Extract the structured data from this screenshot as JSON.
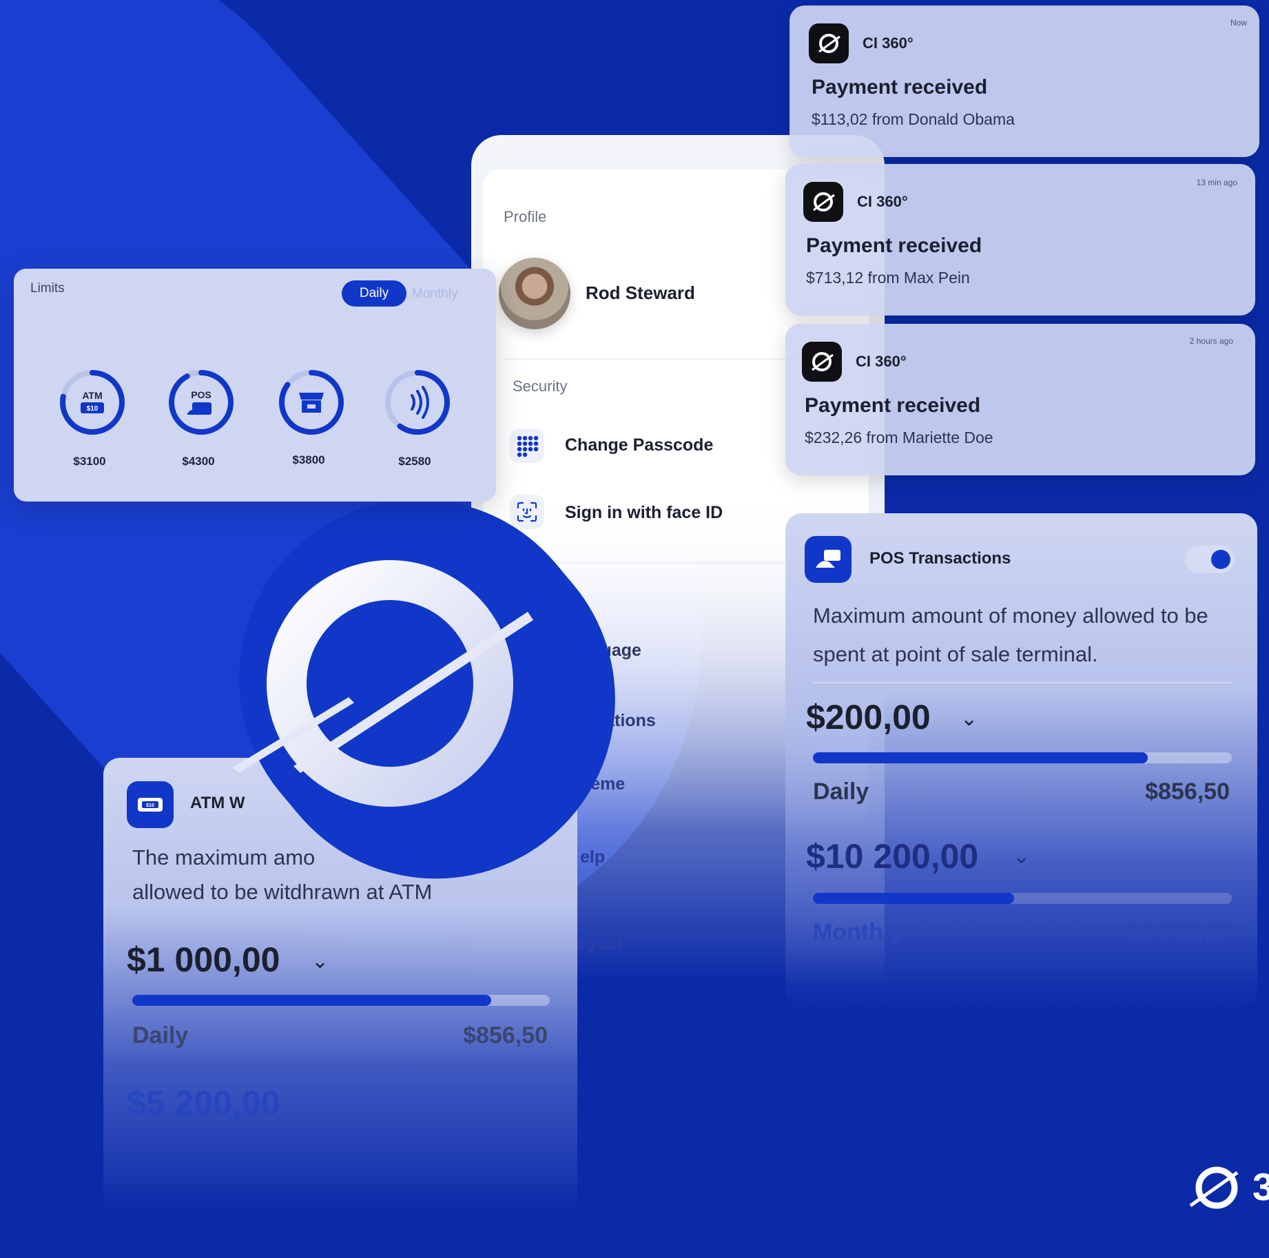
{
  "colors": {
    "background": "#0b2aa8",
    "accent": "#1137c8",
    "card": "#cfd6f2",
    "text_dark": "#1b1f2f"
  },
  "limits": {
    "title": "Limits",
    "tabs": {
      "daily": "Daily",
      "monthly": "Monthly"
    },
    "active_tab": "Daily",
    "items": [
      {
        "icon": "atm-icon",
        "badge_top": "ATM",
        "badge_bottom": "$10",
        "value": "$3100",
        "progress": 0.78
      },
      {
        "icon": "pos-terminal-icon",
        "badge_top": "POS",
        "value": "$4300",
        "progress": 0.92
      },
      {
        "icon": "shop-icon",
        "value": "$3800",
        "progress": 0.85
      },
      {
        "icon": "contactless-icon",
        "value": "$2580",
        "progress": 0.6
      }
    ]
  },
  "profile": {
    "section": "Profile",
    "name": "Rod Steward",
    "security_section": "Security",
    "menu": [
      {
        "icon": "passcode-grid-icon",
        "label": "Change Passcode"
      },
      {
        "icon": "face-id-icon",
        "label": "Sign in with face ID"
      }
    ],
    "general_section_partial": "l",
    "general_items_partial": [
      "nguage",
      "ifications",
      "heme",
      "elp",
      "og out"
    ]
  },
  "notifications": [
    {
      "app": "CI 360°",
      "time": "Now",
      "title": "Payment received",
      "body": "$113,02 from Donald Obama"
    },
    {
      "app": "CI 360°",
      "time": "13 min ago",
      "title": "Payment received",
      "body": "$713,12 from Max Pein"
    },
    {
      "app": "CI 360°",
      "time": "2 hours ago",
      "title": "Payment received",
      "body": "$232,26 from Mariette Doe"
    }
  ],
  "pos": {
    "title": "POS Transactions",
    "toggle_on": true,
    "description": "Maximum amount of money allowed to be spent at point of sale terminal.",
    "daily_amount": "$200,00",
    "daily_label": "Daily",
    "daily_value": "$856,50",
    "daily_progress": 0.8,
    "monthly_amount": "$10 200,00",
    "monthly_label": "Monthly",
    "monthly_value": "$1 506,20",
    "monthly_progress": 0.48
  },
  "atm": {
    "title_partial": "ATM W",
    "description_line1_partial": "The maximum amo",
    "description_line2": "allowed to be witdhrawn at ATM",
    "daily_amount": "$1 000,00",
    "daily_label": "Daily",
    "daily_value": "$856,50",
    "daily_progress": 0.86,
    "monthly_amount": "$5 200,00"
  },
  "brand": {
    "corner_text_partial": "3"
  }
}
